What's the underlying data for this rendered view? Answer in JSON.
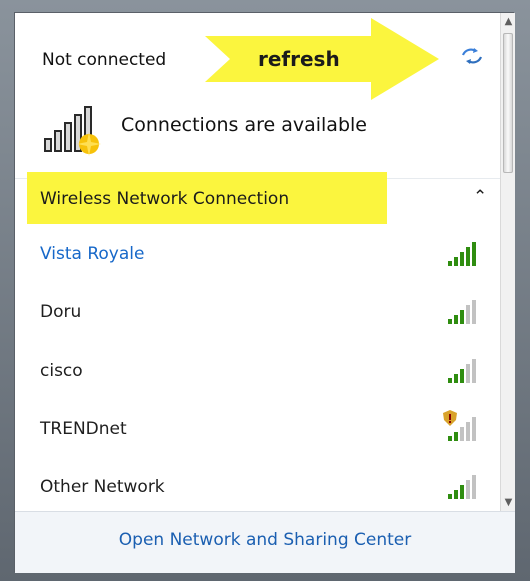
{
  "panel": {
    "status_text": "Not connected",
    "annotation_text": "refresh",
    "refresh_icon": "refresh-icon",
    "connections_text": "Connections are available",
    "connections_icon": "signal-available-icon"
  },
  "section": {
    "title": "Wireless Network Connection",
    "collapse_icon": "chevron-up-icon",
    "highlight_color": "#fbf53e"
  },
  "networks": [
    {
      "name": "Vista Royale",
      "selected": true,
      "signal_level": 5,
      "secured_warning": false
    },
    {
      "name": "Doru",
      "selected": false,
      "signal_level": 3,
      "secured_warning": false
    },
    {
      "name": "cisco",
      "selected": false,
      "signal_level": 3,
      "secured_warning": false
    },
    {
      "name": "TRENDnet",
      "selected": false,
      "signal_level": 2,
      "secured_warning": true
    },
    {
      "name": "Other Network",
      "selected": false,
      "signal_level": 3,
      "secured_warning": false
    }
  ],
  "footer": {
    "link_text": "Open Network and Sharing Center"
  },
  "colors": {
    "link_blue": "#1b5fb1",
    "selected_blue": "#1768c9",
    "signal_green": "#2f8d10"
  }
}
